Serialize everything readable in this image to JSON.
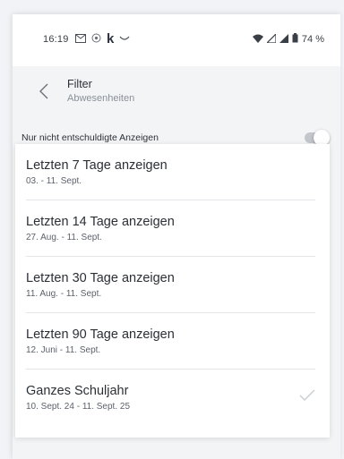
{
  "status_bar": {
    "time": "16:19",
    "battery": "74 %",
    "icons_left": [
      "mail-icon",
      "vibrate-icon",
      "k-app-icon",
      "smile-icon"
    ],
    "icons_right": [
      "wifi-icon",
      "signal-icon",
      "signal-icon",
      "battery-icon"
    ]
  },
  "header": {
    "title": "Filter",
    "subtitle": "Abwesenheiten"
  },
  "toggle": {
    "label": "Nur nicht entschuldigte Anzeigen",
    "checked": false
  },
  "options": [
    {
      "label": "Letzten 7 Tage anzeigen",
      "range": "03. - 11. Sept.",
      "selected": false
    },
    {
      "label": "Letzten 14 Tage anzeigen",
      "range": "27. Aug. - 11. Sept.",
      "selected": false
    },
    {
      "label": "Letzten 30 Tage anzeigen",
      "range": "11. Aug. - 11. Sept.",
      "selected": false
    },
    {
      "label": "Letzten 90 Tage anzeigen",
      "range": "12. Juni - 11. Sept.",
      "selected": false
    },
    {
      "label": "Ganzes Schuljahr",
      "range": "10. Sept. 24 - 11. Sept. 25",
      "selected": true
    }
  ],
  "colors": {
    "background": "#f3f4f6",
    "surface": "#ffffff",
    "text": "#2b2f36",
    "muted": "#8a9099",
    "check": "#c9ccd1"
  }
}
